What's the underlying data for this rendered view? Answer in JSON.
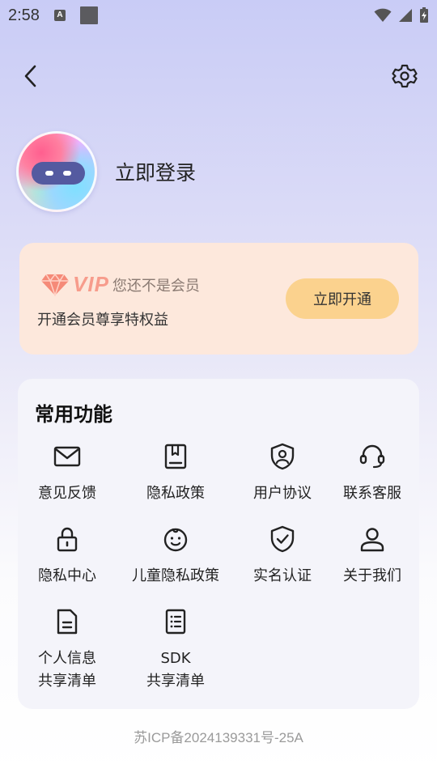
{
  "status_bar": {
    "time": "2:58",
    "notification_icon": "A"
  },
  "nav": {
    "back_icon": "chevron-left-icon",
    "settings_icon": "gear-icon"
  },
  "profile": {
    "login_text": "立即登录"
  },
  "vip": {
    "logo_text": "VIP",
    "not_member": "您还不是会员",
    "subtitle": "开通会员尊享特权益",
    "button_label": "立即开通",
    "accent": "#f79c8c",
    "button_color": "#fbd28e"
  },
  "functions": {
    "title": "常用功能",
    "items": [
      {
        "label": "意见反馈",
        "icon": "mail-icon"
      },
      {
        "label": "隐私政策",
        "icon": "book-icon"
      },
      {
        "label": "用户协议",
        "icon": "shield-user-icon"
      },
      {
        "label": "联系客服",
        "icon": "headset-icon"
      },
      {
        "label": "隐私中心",
        "icon": "lock-icon"
      },
      {
        "label": "儿童隐私政策",
        "icon": "baby-face-icon"
      },
      {
        "label": "实名认证",
        "icon": "shield-check-icon"
      },
      {
        "label": "关于我们",
        "icon": "person-icon"
      },
      {
        "label": "个人信息\n共享清单",
        "icon": "document-icon"
      },
      {
        "label": "SDK\n共享清单",
        "icon": "list-icon"
      }
    ]
  },
  "footer": {
    "icp": "苏ICP备2024139331号-25A"
  }
}
